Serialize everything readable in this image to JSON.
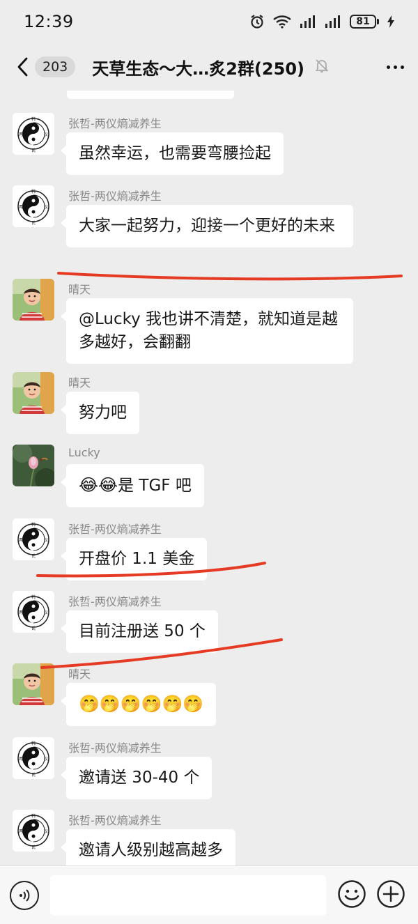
{
  "status": {
    "time": "12:39",
    "battery": "81"
  },
  "header": {
    "unread_count": "203",
    "title": "天草生态～大…炙2群(250)"
  },
  "messages": [
    {
      "sender": "张哲-两仪熵减养生",
      "avatar": "yinyang",
      "text": "虽然幸运，也需要弯腰捡起"
    },
    {
      "sender": "张哲-两仪熵减养生",
      "avatar": "yinyang",
      "text": "大家一起努力，迎接一个更好的未来"
    },
    {
      "sender": "晴天",
      "avatar": "child-photo",
      "text": "@Lucky 我也讲不清楚，就知道是越多越好，会翻翻"
    },
    {
      "sender": "晴天",
      "avatar": "child-photo",
      "text": "努力吧"
    },
    {
      "sender": "Lucky",
      "avatar": "flower-photo",
      "text": "是 TGF 吧",
      "emojis": "😂😂"
    },
    {
      "sender": "张哲-两仪熵减养生",
      "avatar": "yinyang",
      "text": "开盘价 1.1 美金"
    },
    {
      "sender": "张哲-两仪熵减养生",
      "avatar": "yinyang",
      "text": "目前注册送 50 个"
    },
    {
      "sender": "晴天",
      "avatar": "child-photo",
      "text": "",
      "emojis": "🤭🤭🤭🤭🤭🤭"
    },
    {
      "sender": "张哲-两仪熵减养生",
      "avatar": "yinyang",
      "text": "邀请送 30-40 个"
    },
    {
      "sender": "张哲-两仪熵减养生",
      "avatar": "yinyang",
      "text": "邀请人级别越高越多"
    }
  ],
  "input": {
    "value": ""
  },
  "colors": {
    "background": "#ededed",
    "bubble": "#ffffff",
    "annotation": "#e53a23"
  }
}
